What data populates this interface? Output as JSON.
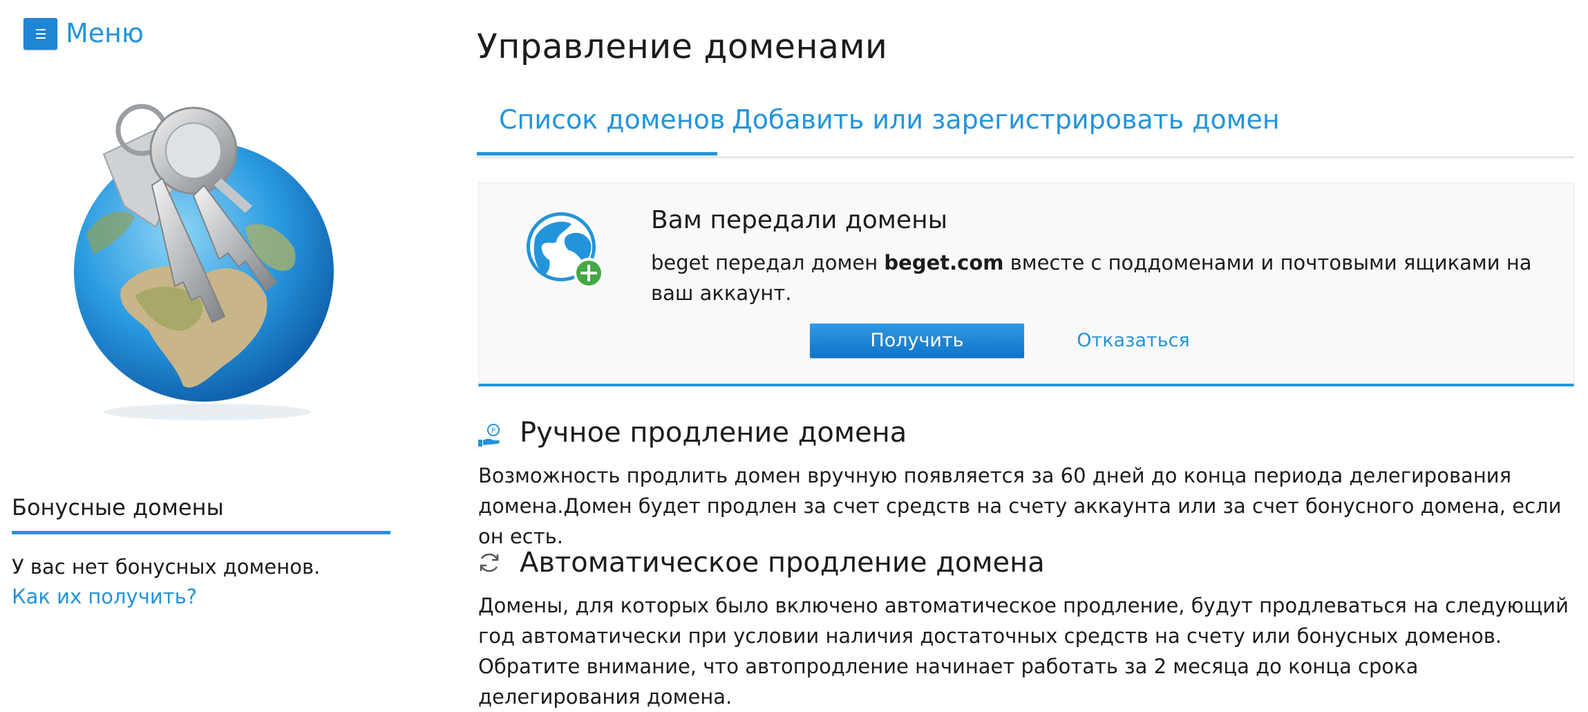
{
  "menu": {
    "label": "Меню"
  },
  "sidebar": {
    "bonus_title": "Бонусные домены",
    "bonus_empty": "У вас нет бонусных доменов.",
    "bonus_link": "Как их получить?"
  },
  "main": {
    "title": "Управление доменами",
    "tabs": [
      {
        "label": "Список доменов",
        "active": true
      },
      {
        "label": "Добавить или зарегистрировать домен",
        "active": false
      }
    ],
    "notice": {
      "title": "Вам передали домены",
      "body_prefix": "beget передал домен ",
      "domain": "beget.com",
      "body_suffix": " вместе с поддоменами и почтовыми ящиками на ваш аккаунт.",
      "accept_label": "Получить",
      "decline_label": "Отказаться"
    },
    "manual_renewal": {
      "title": "Ручное продление домена",
      "text": "Возможность продлить домен вручную появляется за 60 дней до конца периода делегирования домена.Домен будет продлен за счет средств на счету аккаунта или за счет бонусного домена, если он есть."
    },
    "auto_renewal": {
      "title": "Автоматическое продление домена",
      "text1": "Домены, для которых было включено автоматическое продление, будут продлеваться на следующий год автоматически при условии наличия достаточных средств на счету или бонусных доменов.",
      "text2": "Обратите внимание, что автопродление начинает работать за 2 месяца до конца срока делегирования домена."
    }
  },
  "colors": {
    "accent": "#2394db",
    "button": "#1f86d6",
    "text": "#1c1c1c"
  }
}
